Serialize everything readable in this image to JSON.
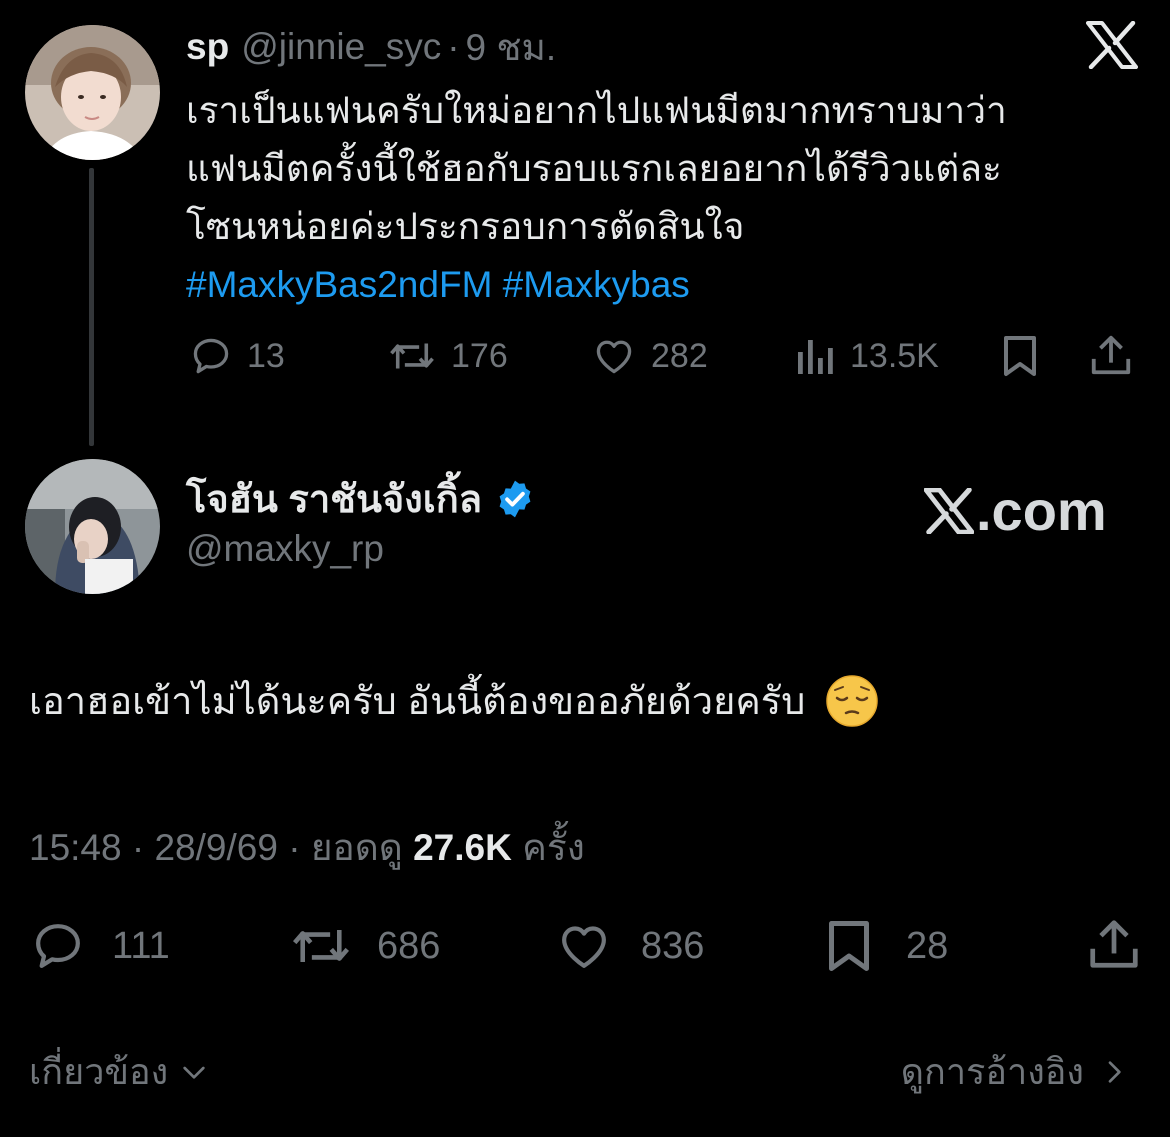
{
  "parent_tweet": {
    "display_name": "sp",
    "handle": "@jinnie_syc",
    "separator": "·",
    "time": "9 ชม.",
    "text_lines": [
      "เราเป็นแฟนครับใหม่อยากไปแฟนมีตมากทราบมาว่า",
      "แฟนมีตครั้งนี้ใช้ฮอกับรอบแรกเลยอยากได้รีวิวแต่ละ",
      "โซนหน่อยค่ะประกรอบการตัดสินใจ"
    ],
    "hashtags": "#MaxkyBas2ndFM #Maxkybas",
    "stats": {
      "replies": "13",
      "reposts": "176",
      "likes": "282",
      "views": "13.5K"
    }
  },
  "main_tweet": {
    "display_name": "โจฮัน ราชันจังเกิ้ล",
    "handle": "@maxky_rp",
    "text": "เอาฮอเข้าไม่ได้นะครับ อันนี้ต้องขออภัยด้วยครับ",
    "emoji": "pensive-face",
    "time": "15:48",
    "date": "28/9/69",
    "separator": "·",
    "views_label": "ยอดดู",
    "views": "27.6K",
    "views_suffix": "ครั้ง",
    "stats": {
      "replies": "111",
      "reposts": "686",
      "likes": "836",
      "bookmarks": "28"
    }
  },
  "watermark": ".com",
  "footer": {
    "related_label": "เกี่ยวข้อง",
    "quotes_label": "ดูการอ้างอิง"
  },
  "colors": {
    "background": "#000000",
    "text": "#e7e9ea",
    "muted": "#71767b",
    "link": "#1d9bf0",
    "verified": "#1d9bf0"
  }
}
